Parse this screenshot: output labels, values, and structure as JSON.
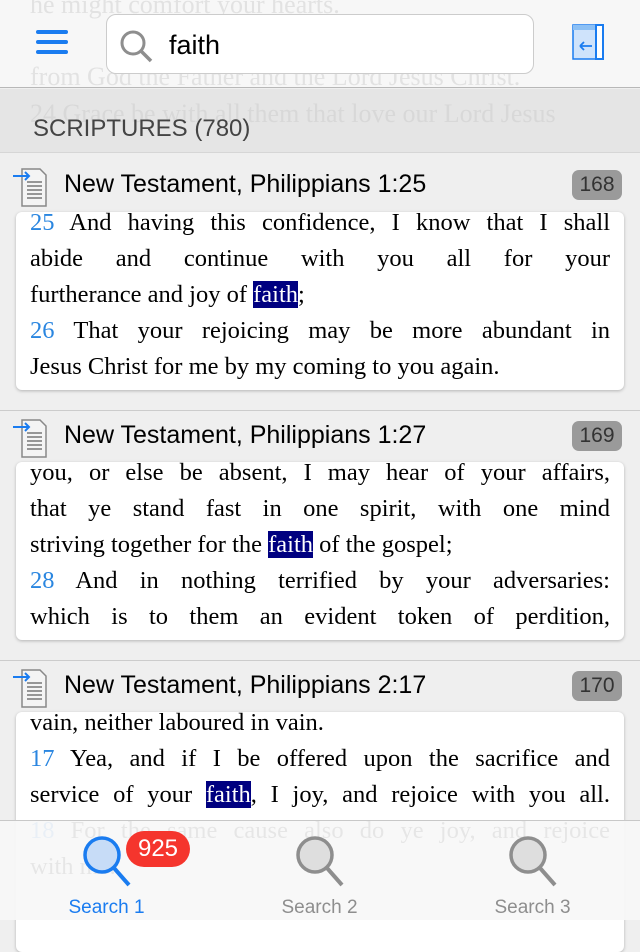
{
  "background_text": [
    "he might comfort your hearts.",
    "from God the Father and the Lord Jesus Christ.",
    "24 Grace be with all them that love our Lord Jesus"
  ],
  "search": {
    "value": "faith",
    "icon": "search-icon"
  },
  "menu_icon": "hamburger-icon",
  "panel_icon": "collapse-panel-icon",
  "section": {
    "title": "SCRIPTURES (780)"
  },
  "results": [
    {
      "title": "New Testament, Philippians 1:25",
      "badge": "168",
      "lines": [
        {
          "j": true,
          "segs": [
            {
              "t": "25",
              "c": "num"
            },
            {
              "t": " And having this confidence, I know that I shall",
              "c": ""
            }
          ]
        },
        {
          "j": true,
          "segs": [
            {
              "t": "abide and continue with you all for your",
              "c": ""
            }
          ]
        },
        {
          "j": false,
          "segs": [
            {
              "t": "furtherance and joy of ",
              "c": ""
            },
            {
              "t": "faith",
              "c": "hl"
            },
            {
              "t": ";",
              "c": ""
            }
          ]
        },
        {
          "j": true,
          "segs": [
            {
              "t": "26",
              "c": "num"
            },
            {
              "t": " That your rejoicing may be more abundant in",
              "c": ""
            }
          ]
        },
        {
          "j": false,
          "segs": [
            {
              "t": "Jesus Christ for me by my coming to you again.",
              "c": ""
            }
          ]
        }
      ]
    },
    {
      "title": "New Testament, Philippians 1:27",
      "badge": "169",
      "lines": [
        {
          "j": true,
          "segs": [
            {
              "t": "you, or else be absent, I may hear of your affairs,",
              "c": ""
            }
          ]
        },
        {
          "j": true,
          "segs": [
            {
              "t": "that ye stand fast in one spirit, with one mind",
              "c": ""
            }
          ]
        },
        {
          "j": false,
          "segs": [
            {
              "t": "striving together for the ",
              "c": ""
            },
            {
              "t": "faith",
              "c": "hl"
            },
            {
              "t": " of the gospel;",
              "c": ""
            }
          ]
        },
        {
          "j": true,
          "segs": [
            {
              "t": "28",
              "c": "num"
            },
            {
              "t": " And in nothing terrified by your adversaries:",
              "c": ""
            }
          ]
        },
        {
          "j": true,
          "segs": [
            {
              "t": "which is to them an evident token of perdition,",
              "c": ""
            }
          ]
        }
      ]
    },
    {
      "title": "New Testament, Philippians 2:17",
      "badge": "170",
      "lines": [
        {
          "j": false,
          "segs": [
            {
              "t": "vain, neither laboured in vain.",
              "c": ""
            }
          ]
        },
        {
          "j": true,
          "segs": [
            {
              "t": "17",
              "c": "num"
            },
            {
              "t": " Yea, and if I be offered upon the sacrifice and",
              "c": ""
            }
          ]
        },
        {
          "j": true,
          "segs": [
            {
              "t": "service of your ",
              "c": ""
            },
            {
              "t": "faith",
              "c": "hl"
            },
            {
              "t": ", I joy, and rejoice with you all.",
              "c": ""
            }
          ]
        },
        {
          "j": true,
          "segs": [
            {
              "t": "18",
              "c": "num"
            },
            {
              "t": " For the same cause also do ye joy, and rejoice",
              "c": ""
            }
          ]
        },
        {
          "j": false,
          "segs": [
            {
              "t": "with me.",
              "c": ""
            }
          ]
        }
      ]
    }
  ],
  "tabs": [
    {
      "label": "Search 1",
      "badge": "925",
      "active": true
    },
    {
      "label": "Search 2",
      "active": false
    },
    {
      "label": "Search 3",
      "active": false
    }
  ],
  "colors": {
    "accent": "#1a7cf0",
    "highlight": "#000080",
    "verse_number": "#2a86e0",
    "badge_red": "#f5352d"
  }
}
